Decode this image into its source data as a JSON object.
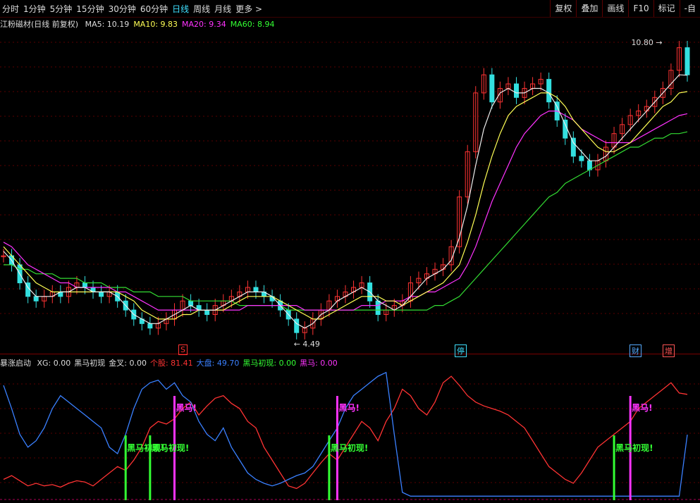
{
  "toolbar": {
    "periods": [
      "分时",
      "1分钟",
      "5分钟",
      "15分钟",
      "30分钟",
      "60分钟",
      "日线",
      "周线",
      "月线",
      "更多 >"
    ],
    "active_period": "日线",
    "right_buttons": [
      "复权",
      "叠加",
      "画线",
      "F10",
      "标记",
      "-自"
    ]
  },
  "main_chart": {
    "title": "江粉磁材(日线 前复权)",
    "ma": [
      {
        "label": "MA5:",
        "value": "10.19",
        "color": "#dddddd"
      },
      {
        "label": "MA10:",
        "value": "9.83",
        "color": "#ffff55"
      },
      {
        "label": "MA20:",
        "value": "9.34",
        "color": "#ff33ff"
      },
      {
        "label": "MA60:",
        "value": "8.94",
        "color": "#33ff33"
      }
    ],
    "high_label": "10.80",
    "low_label": "4.49",
    "event_marks": [
      {
        "text": "S",
        "color": "#ff3333"
      },
      {
        "text": "停",
        "color": "#3fe0ff"
      },
      {
        "text": "财",
        "color": "#55aaff"
      },
      {
        "text": "增",
        "color": "#ff5555"
      }
    ],
    "close_series": [
      6.2,
      6.0,
      5.6,
      5.3,
      5.2,
      5.3,
      5.4,
      5.3,
      5.5,
      5.6,
      5.5,
      5.4,
      5.3,
      5.4,
      5.2,
      5.0,
      4.8,
      4.7,
      4.6,
      4.7,
      4.8,
      5.0,
      5.2,
      5.1,
      5.0,
      4.9,
      5.1,
      5.2,
      5.3,
      5.4,
      5.5,
      5.4,
      5.3,
      5.2,
      5.0,
      4.8,
      4.5,
      4.6,
      4.8,
      5.0,
      5.2,
      5.3,
      5.4,
      5.5,
      5.6,
      5.2,
      4.9,
      5.0,
      5.1,
      5.2,
      5.6,
      5.7,
      5.8,
      5.9,
      6.0,
      6.4,
      7.5,
      8.5,
      9.8,
      10.2,
      9.6,
      9.9,
      10.0,
      9.7,
      9.9,
      10.0,
      10.1,
      9.6,
      9.2,
      8.8,
      8.4,
      8.3,
      8.1,
      8.3,
      8.6,
      8.9,
      9.1,
      9.3,
      9.4,
      9.5,
      9.7,
      9.9,
      10.3,
      10.8,
      10.2
    ],
    "ma5_series": [
      6.3,
      6.1,
      5.8,
      5.5,
      5.3,
      5.3,
      5.3,
      5.4,
      5.4,
      5.5,
      5.5,
      5.4,
      5.4,
      5.4,
      5.3,
      5.1,
      4.9,
      4.8,
      4.7,
      4.7,
      4.8,
      4.9,
      5.0,
      5.1,
      5.0,
      5.0,
      5.0,
      5.1,
      5.2,
      5.3,
      5.4,
      5.4,
      5.4,
      5.3,
      5.1,
      4.9,
      4.7,
      4.6,
      4.7,
      4.9,
      5.0,
      5.2,
      5.3,
      5.4,
      5.5,
      5.4,
      5.2,
      5.1,
      5.0,
      5.1,
      5.3,
      5.5,
      5.7,
      5.8,
      5.9,
      6.1,
      6.6,
      7.3,
      8.2,
      9.0,
      9.5,
      9.8,
      9.9,
      9.8,
      9.8,
      9.9,
      9.9,
      9.8,
      9.5,
      9.1,
      8.7,
      8.5,
      8.3,
      8.3,
      8.4,
      8.6,
      8.8,
      9.0,
      9.2,
      9.4,
      9.6,
      9.8,
      10.0,
      10.2,
      10.19
    ],
    "ma10_series": [
      6.4,
      6.2,
      6.0,
      5.8,
      5.6,
      5.5,
      5.4,
      5.4,
      5.4,
      5.4,
      5.4,
      5.4,
      5.4,
      5.4,
      5.4,
      5.3,
      5.2,
      5.0,
      4.9,
      4.8,
      4.8,
      4.8,
      4.9,
      4.9,
      5.0,
      5.0,
      5.0,
      5.0,
      5.1,
      5.2,
      5.3,
      5.3,
      5.3,
      5.3,
      5.2,
      5.1,
      5.0,
      4.9,
      4.8,
      4.8,
      4.9,
      5.0,
      5.1,
      5.2,
      5.3,
      5.3,
      5.3,
      5.2,
      5.2,
      5.1,
      5.2,
      5.3,
      5.4,
      5.5,
      5.6,
      5.8,
      6.0,
      6.5,
      7.1,
      7.8,
      8.4,
      8.9,
      9.3,
      9.5,
      9.6,
      9.7,
      9.8,
      9.8,
      9.7,
      9.5,
      9.2,
      9.0,
      8.8,
      8.6,
      8.5,
      8.5,
      8.6,
      8.7,
      8.9,
      9.1,
      9.3,
      9.5,
      9.6,
      9.8,
      9.83
    ],
    "ma20_series": [
      6.5,
      6.4,
      6.2,
      6.0,
      5.9,
      5.8,
      5.7,
      5.6,
      5.6,
      5.5,
      5.5,
      5.5,
      5.5,
      5.5,
      5.4,
      5.4,
      5.3,
      5.2,
      5.1,
      5.0,
      5.0,
      5.0,
      5.0,
      5.0,
      5.0,
      5.0,
      5.0,
      5.0,
      5.0,
      5.0,
      5.1,
      5.1,
      5.1,
      5.1,
      5.1,
      5.1,
      5.1,
      5.0,
      5.0,
      5.0,
      5.0,
      5.0,
      5.0,
      5.0,
      5.1,
      5.1,
      5.1,
      5.2,
      5.2,
      5.2,
      5.3,
      5.3,
      5.4,
      5.4,
      5.5,
      5.6,
      5.7,
      6.0,
      6.4,
      6.9,
      7.4,
      7.8,
      8.2,
      8.6,
      8.9,
      9.1,
      9.3,
      9.4,
      9.4,
      9.3,
      9.2,
      9.0,
      8.9,
      8.8,
      8.7,
      8.7,
      8.7,
      8.7,
      8.8,
      8.9,
      9.0,
      9.1,
      9.2,
      9.3,
      9.34
    ],
    "ma60_series": [
      6.0,
      6.0,
      5.9,
      5.9,
      5.8,
      5.8,
      5.8,
      5.7,
      5.7,
      5.7,
      5.6,
      5.6,
      5.6,
      5.5,
      5.5,
      5.5,
      5.4,
      5.4,
      5.4,
      5.3,
      5.3,
      5.3,
      5.3,
      5.2,
      5.2,
      5.2,
      5.2,
      5.2,
      5.2,
      5.1,
      5.1,
      5.1,
      5.1,
      5.1,
      5.1,
      5.0,
      5.0,
      5.0,
      5.0,
      5.0,
      5.0,
      5.0,
      5.0,
      5.0,
      5.0,
      5.0,
      5.0,
      5.0,
      5.0,
      5.0,
      5.0,
      5.0,
      5.0,
      5.1,
      5.1,
      5.2,
      5.3,
      5.5,
      5.7,
      5.9,
      6.1,
      6.3,
      6.5,
      6.7,
      6.9,
      7.1,
      7.3,
      7.5,
      7.6,
      7.8,
      7.9,
      8.0,
      8.1,
      8.2,
      8.3,
      8.4,
      8.5,
      8.6,
      8.6,
      8.7,
      8.8,
      8.8,
      8.9,
      8.9,
      8.94
    ]
  },
  "indicator": {
    "name": "暴涨启动",
    "fields": [
      {
        "label": "XG:",
        "value": "0.00",
        "color": "#dddddd"
      },
      {
        "label": "黑马初现",
        "value": "",
        "color": "#dddddd"
      },
      {
        "label": "金叉:",
        "value": "0.00",
        "color": "#dddddd"
      },
      {
        "label": "个股:",
        "value": "81.41",
        "color": "#ff3333"
      },
      {
        "label": "大盘:",
        "value": "49.70",
        "color": "#3a80ff"
      },
      {
        "label": "黑马初现:",
        "value": "0.00",
        "color": "#33ff33"
      },
      {
        "label": "黑马:",
        "value": "0.00",
        "color": "#ff33ff"
      }
    ],
    "signal_text_chuxian": "黑马初现!",
    "signal_text_heima": "黑马!",
    "stock_series": [
      15,
      18,
      14,
      10,
      12,
      10,
      11,
      9,
      12,
      14,
      13,
      10,
      15,
      20,
      25,
      22,
      30,
      40,
      55,
      60,
      58,
      62,
      70,
      75,
      65,
      72,
      78,
      80,
      74,
      70,
      60,
      55,
      40,
      30,
      20,
      10,
      8,
      12,
      20,
      28,
      35,
      30,
      40,
      50,
      60,
      55,
      45,
      60,
      70,
      85,
      80,
      70,
      65,
      75,
      90,
      95,
      88,
      80,
      75,
      72,
      70,
      68,
      65,
      60,
      55,
      45,
      35,
      25,
      20,
      15,
      12,
      20,
      30,
      40,
      45,
      50,
      55,
      60,
      70,
      75,
      80,
      85,
      90,
      82,
      81
    ],
    "market_series": [
      88,
      70,
      50,
      40,
      45,
      55,
      70,
      80,
      75,
      70,
      65,
      60,
      55,
      40,
      35,
      50,
      70,
      85,
      90,
      92,
      85,
      90,
      80,
      75,
      60,
      50,
      45,
      55,
      40,
      30,
      20,
      15,
      12,
      10,
      12,
      15,
      18,
      20,
      25,
      35,
      45,
      55,
      70,
      80,
      85,
      90,
      95,
      98,
      50,
      5,
      2,
      2,
      2,
      2,
      2,
      2,
      2,
      2,
      2,
      2,
      2,
      2,
      2,
      2,
      2,
      2,
      2,
      2,
      2,
      2,
      2,
      2,
      2,
      2,
      2,
      2,
      2,
      2,
      2,
      2,
      2,
      2,
      2,
      2,
      49.7
    ]
  }
}
